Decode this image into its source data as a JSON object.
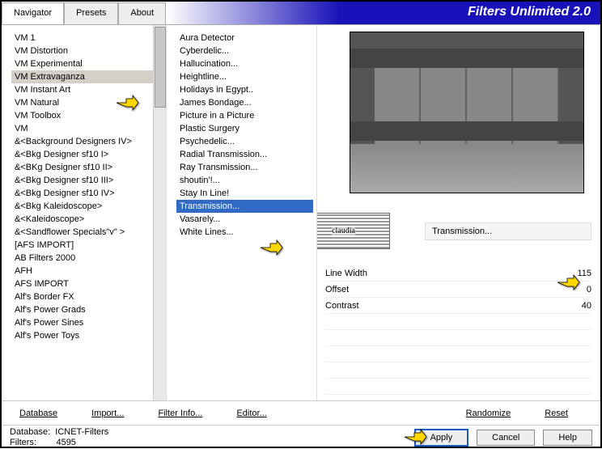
{
  "title": "Filters Unlimited 2.0",
  "tabs": [
    "Navigator",
    "Presets",
    "About"
  ],
  "activeTab": 0,
  "categories": [
    "VM 1",
    "VM Distortion",
    "VM Experimental",
    "VM Extravaganza",
    "VM Instant Art",
    "VM Natural",
    "VM Toolbox",
    "VM",
    "&<Background Designers IV>",
    "&<Bkg Designer sf10 I>",
    "&<BKg Designer sf10 II>",
    "&<Bkg Designer sf10 III>",
    "&<Bkg Designer sf10 IV>",
    "&<Bkg Kaleidoscope>",
    "&<Kaleidoscope>",
    "&<Sandflower Specials\"v\" >",
    "[AFS IMPORT]",
    "AB Filters 2000",
    "AFH",
    "AFS IMPORT",
    "Alf's Border FX",
    "Alf's Power Grads",
    "Alf's Power Sines",
    "Alf's Power Toys"
  ],
  "selectedCategoryIdx": 3,
  "filters": [
    "Aura Detector",
    "Cyberdelic...",
    "Hallucination...",
    "Heightline...",
    "Holidays in Egypt..",
    "James Bondage...",
    "Picture in a Picture",
    "Plastic Surgery",
    "Psychedelic...",
    "Radial Transmission...",
    "Ray Transmission...",
    "shoutin'!...",
    "Stay In Line!",
    "Transmission...",
    "Vasarely...",
    "White Lines..."
  ],
  "selectedFilterIdx": 13,
  "currentFilter": "Transmission...",
  "watermark": "claudia",
  "params": [
    {
      "name": "Line Width",
      "value": 115
    },
    {
      "name": "Offset",
      "value": 0
    },
    {
      "name": "Contrast",
      "value": 40
    }
  ],
  "footerLinks": {
    "database": "Database",
    "import": "Import...",
    "filterInfo": "Filter Info...",
    "editor": "Editor...",
    "randomize": "Randomize",
    "reset": "Reset"
  },
  "status": {
    "dbLabel": "Database:",
    "dbName": "ICNET-Filters",
    "filtLabel": "Filters:",
    "filtCount": "4595"
  },
  "buttons": {
    "apply": "Apply",
    "cancel": "Cancel",
    "help": "Help"
  }
}
